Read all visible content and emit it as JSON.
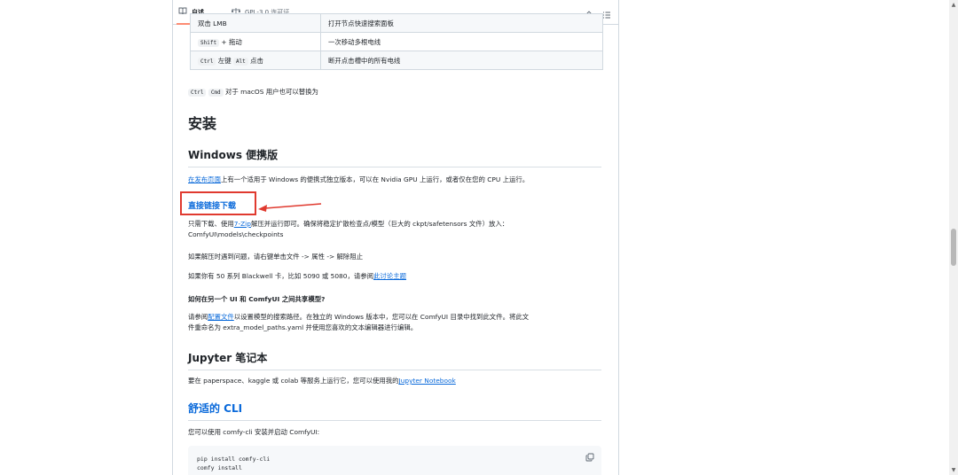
{
  "tabs": [
    {
      "label": "自述"
    },
    {
      "label": "GPL-3.0 许可证"
    }
  ],
  "icons": {
    "readme": "book-icon",
    "license": "law-icon",
    "edit": "pencil-icon",
    "toc": "list-icon",
    "copy": "copy-icon"
  },
  "shortcuts": [
    {
      "key": "双击 LMB",
      "desc": "打开节点快速搜索面板"
    },
    {
      "key_kbd": "Shift",
      "key_text": " + 拖动",
      "desc": "一次移动多根电线"
    },
    {
      "key_kbd": "Ctrl",
      "key_mid": " 左键 ",
      "key_kbd2": "Alt",
      "key_text": " 点击",
      "desc": "断开点击槽中的所有电线"
    }
  ],
  "mac_note": {
    "kbd1": "Ctrl",
    "kbd2": "Cmd",
    "text": " 对于 macOS 用户也可以替换为"
  },
  "install": {
    "h1": "安装",
    "windows_h2": "Windows 便携版",
    "windows_link": "在发布页面",
    "windows_text": "上有一个适用于 Windows 的便携式独立版本，可以在 Nvidia GPU 上运行，或者仅在您的 CPU 上运行。",
    "direct_h3": "直接链接下载",
    "direct_p1_a": "只需下载、使用",
    "direct_p1_link": "7-Zip",
    "direct_p1_b": "解压并运行即可。确保将稳定扩散检查点/模型（巨大的 ckpt/safetensors 文件）放入：",
    "direct_p1_c": "ComfyUI\\models\\checkpoints",
    "direct_p2": "如果解压时遇到问题，请右键单击文件 -> 属性 -> 解除阻止",
    "direct_p3_a": "如果你有 50 系列 Blackwell 卡，比如 5090 或 5080，请参阅",
    "direct_p3_link": "此讨论主题",
    "share_h4": "如何在另一个 UI 和 ComfyUI 之间共享模型?",
    "share_p_a": "请参阅",
    "share_p_link": "配置文件",
    "share_p_b": "以设置模型的搜索路径。在独立的 Windows 版本中，您可以在 ComfyUI 目录中找到此文件。将此文",
    "share_p_c": "件重命名为 extra_model_paths.yaml 并使用您喜欢的文本编辑器进行编辑。",
    "jupyter_h2": "Jupyter 笔记本",
    "jupyter_p_a": "要在 paperspace、kaggle 或 colab 等服务上运行它，您可以使用我的",
    "jupyter_p_link": "Jupyter Notebook",
    "cli_h2": "舒适的 CLI",
    "cli_p": "您可以使用 comfy-cli 安装并启动 ComfyUI:",
    "code_lines": [
      "pip install comfy-cli",
      "comfy install"
    ]
  },
  "colors": {
    "link": "#0969da",
    "highlight_box": "#e03a2f",
    "tab_underline": "#fd8c73"
  }
}
